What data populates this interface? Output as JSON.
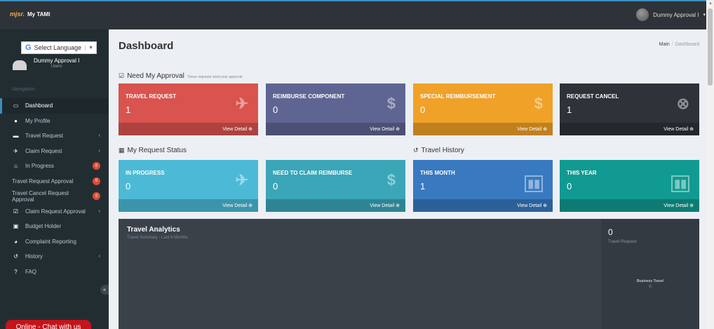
{
  "topbar": {
    "logo_text": "mjsr.",
    "app_name": "My TAMI",
    "user_menu_label": "Dummy Approval I"
  },
  "sidebar": {
    "language_select": "Select Language",
    "user_name": "Dummy Approval I",
    "user_role": "Users",
    "nav_header": "Navigation",
    "items": [
      {
        "label": "Dashboard",
        "icon": "desktop-icon"
      },
      {
        "label": "My Profile",
        "icon": "user-icon"
      },
      {
        "label": "Travel Request",
        "icon": "briefcase-icon"
      },
      {
        "label": "Claim Request",
        "icon": "plane-icon"
      },
      {
        "label": "In Progress",
        "icon": "bank-icon",
        "badge": "0"
      },
      {
        "label": "Travel Request Approval",
        "badge": "0"
      },
      {
        "label": "Travel Cancel Request Approval",
        "badge": "0"
      },
      {
        "label": "Claim Request Approval",
        "icon": "check-square-icon"
      },
      {
        "label": "Budget Holder",
        "icon": "money-icon"
      },
      {
        "label": "Complaint Reporting",
        "icon": "comments-icon"
      },
      {
        "label": "History",
        "icon": "history-icon"
      },
      {
        "label": "FAQ",
        "icon": "question-icon"
      }
    ],
    "chat_button": "Online - Chat with us"
  },
  "header": {
    "title": "Dashboard",
    "breadcrumb_main": "Main",
    "breadcrumb_current": "Dashboard"
  },
  "sections": {
    "approval_title": "Need My Approval",
    "approval_sub": "These requests need your approval",
    "request_status_title": "My Request Status",
    "travel_history_title": "Travel History"
  },
  "boxes": {
    "view_detail": "View Detail",
    "travel_request": {
      "label": "TRAVEL REQUEST",
      "value": "1"
    },
    "reimburse_component": {
      "label": "REIMBURSE COMPONENT",
      "value": "0"
    },
    "special_reimbursement": {
      "label": "SPECIAL REIMBURSEMENT",
      "value": "0"
    },
    "request_cancel": {
      "label": "REQUEST CANCEL",
      "value": "1"
    },
    "in_progress": {
      "label": "IN PROGRESS",
      "value": "0"
    },
    "need_to_claim": {
      "label": "NEED TO CLAIM REIMBURSE",
      "value": "0"
    },
    "this_month": {
      "label": "THIS MONTH",
      "value": "1"
    },
    "this_year": {
      "label": "THIS YEAR",
      "value": "0"
    }
  },
  "analytics": {
    "title": "Travel Analytics",
    "subtitle": "Travel Summary - Last 6 Months",
    "side_value": "0",
    "side_label": "Travel Request",
    "business_travel_label": "Business Travel",
    "business_travel_value": "0"
  }
}
